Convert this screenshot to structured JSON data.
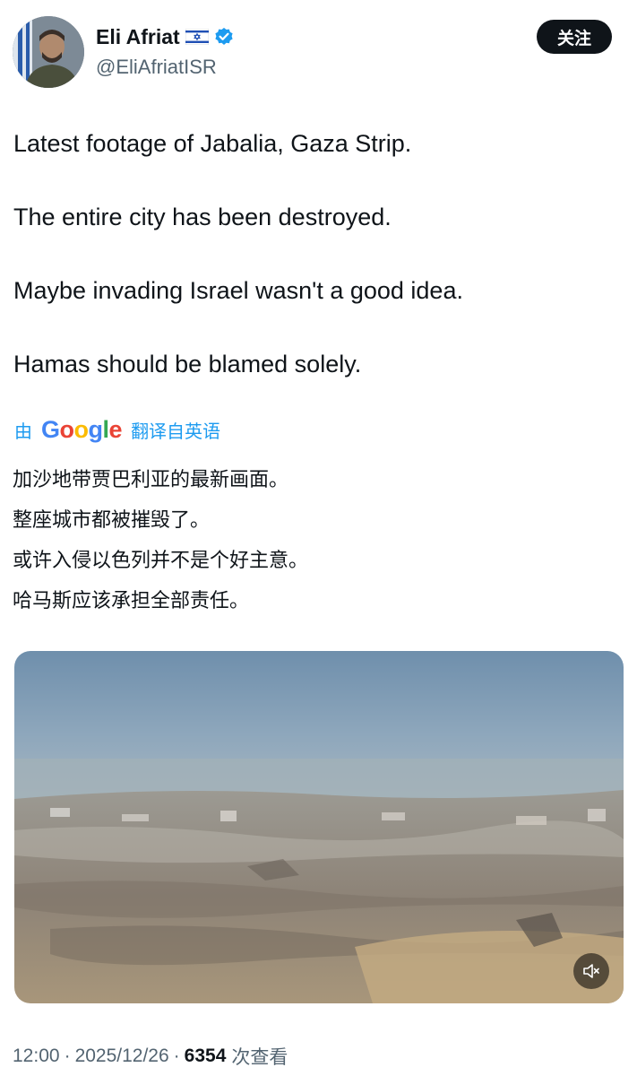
{
  "author": {
    "name": "Eli Afriat",
    "handle": "@EliAfriatISR",
    "flag_icon": "israel-flag-icon",
    "verified_icon": "verified-badge-icon",
    "verified_color": "#1d9bf0"
  },
  "follow_button": {
    "label": "关注"
  },
  "tweet": {
    "lines": [
      "Latest footage of Jabalia, Gaza Strip.",
      "The entire city has been destroyed.",
      "Maybe invading Israel wasn't a good idea.",
      "Hamas should be blamed solely."
    ]
  },
  "translation": {
    "prefix": "由",
    "provider": "Google",
    "suffix": "翻译自英语",
    "lines": [
      "加沙地带贾巴利亚的最新画面。",
      "整座城市都被摧毁了。",
      "或许入侵以色列并不是个好主意。",
      "哈马斯应该承担全部责任。"
    ]
  },
  "media": {
    "type": "video",
    "mute_icon": "muted-speaker-icon"
  },
  "meta": {
    "time": "12:00",
    "separator": "·",
    "date": "2025/12/26",
    "views_count": "6354",
    "views_label": "次查看"
  },
  "colors": {
    "accent": "#1d9bf0",
    "text": "#0f1419",
    "muted": "#536471",
    "follow_bg": "#0f1419"
  }
}
